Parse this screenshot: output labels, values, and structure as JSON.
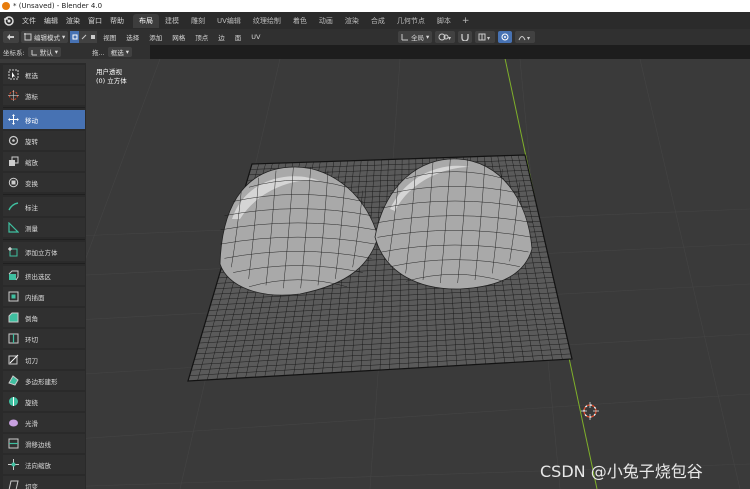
{
  "window": {
    "title": "* (Unsaved) - Blender 4.0"
  },
  "menu": {
    "items": [
      "文件",
      "编辑",
      "渲染",
      "窗口",
      "帮助"
    ]
  },
  "workspace_tabs": [
    "布局",
    "建模",
    "雕刻",
    "UV编辑",
    "纹理绘制",
    "着色",
    "动画",
    "渲染",
    "合成",
    "几何节点",
    "脚本"
  ],
  "workspace_add": "+",
  "header": {
    "mode": "编辑模式",
    "menus": [
      "视图",
      "选择",
      "添加",
      "网格",
      "顶点",
      "边",
      "面",
      "UV"
    ],
    "transform_orientation": "全局"
  },
  "tool_settings": {
    "coord_label": "坐标系:",
    "coord_value": "默认",
    "drag_label": "拖...",
    "drag_value": "框选"
  },
  "viewport": {
    "view_name": "用户透视",
    "object_name": "(0) 立方体"
  },
  "tools": [
    {
      "label": "框选",
      "icon": "box-select-icon"
    },
    {
      "label": "游标",
      "icon": "cursor-icon"
    },
    {
      "label": "移动",
      "icon": "move-icon",
      "active": true
    },
    {
      "label": "旋转",
      "icon": "rotate-icon"
    },
    {
      "label": "缩放",
      "icon": "scale-icon"
    },
    {
      "label": "变换",
      "icon": "transform-icon"
    },
    {
      "label": "标注",
      "icon": "annotate-icon"
    },
    {
      "label": "测量",
      "icon": "measure-icon"
    },
    {
      "label": "添加立方体",
      "icon": "add-cube-icon"
    },
    {
      "label": "挤出选区",
      "icon": "extrude-icon"
    },
    {
      "label": "内插面",
      "icon": "inset-icon"
    },
    {
      "label": "倒角",
      "icon": "bevel-icon"
    },
    {
      "label": "环切",
      "icon": "loop-cut-icon"
    },
    {
      "label": "切刀",
      "icon": "knife-icon"
    },
    {
      "label": "多边形建形",
      "icon": "poly-build-icon"
    },
    {
      "label": "旋绕",
      "icon": "spin-icon"
    },
    {
      "label": "光滑",
      "icon": "smooth-icon"
    },
    {
      "label": "滑移边线",
      "icon": "edge-slide-icon"
    },
    {
      "label": "法向缩放",
      "icon": "shrink-fatten-icon"
    },
    {
      "label": "切变",
      "icon": "shear-icon"
    }
  ],
  "watermark": "CSDN @小兔子烧包谷",
  "colors": {
    "accent": "#4772b3",
    "y_axis": "#7fb02a",
    "viewport_bg": "#3a3a3a"
  }
}
